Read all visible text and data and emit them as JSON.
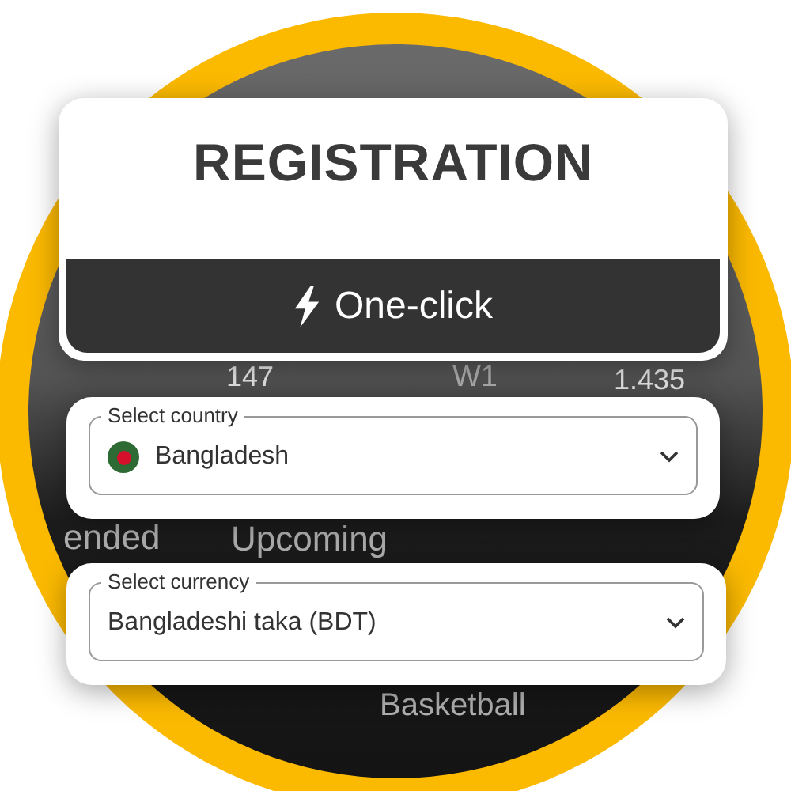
{
  "background": {
    "texts": [
      {
        "text": "147",
        "kind": "odds"
      },
      {
        "text": "W1",
        "kind": "label"
      },
      {
        "text": "1.435",
        "kind": "odds"
      },
      {
        "text": "ended",
        "kind": "label"
      },
      {
        "text": "Upcoming",
        "kind": "label"
      },
      {
        "text": "Basketball",
        "kind": "label"
      }
    ]
  },
  "registration": {
    "title": "REGISTRATION",
    "button": "One-click"
  },
  "country": {
    "label": "Select country",
    "value": "Bangladesh"
  },
  "currency": {
    "label": "Select currency",
    "value": "Bangladeshi taka (BDT)"
  }
}
